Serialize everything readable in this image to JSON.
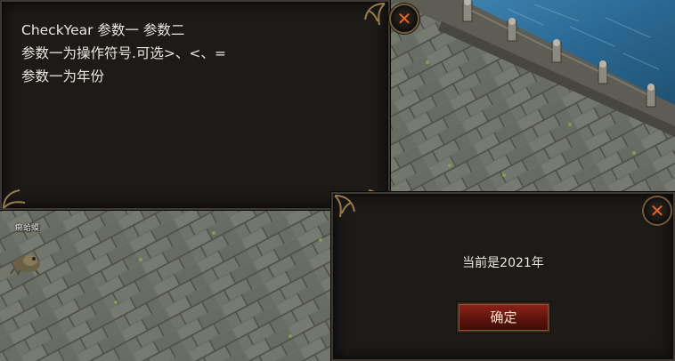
{
  "top_panel": {
    "lines": [
      "CheckYear 参数一 参数二",
      "参数一为操作符号.可选>、<、=",
      "参数一为年份"
    ],
    "close_icon": "close-icon"
  },
  "dialog": {
    "message": "当前是2021年",
    "confirm_label": "确定",
    "close_icon": "close-icon"
  },
  "world": {
    "npc_name": "癞蛤蟆"
  },
  "colors": {
    "panel_bg": "#1d1b18",
    "text": "#ece7de",
    "close_x": "#e8632a",
    "confirm_bg": "#6e1a10",
    "water": "#2f6f9a",
    "stone": "#6b6e64"
  }
}
